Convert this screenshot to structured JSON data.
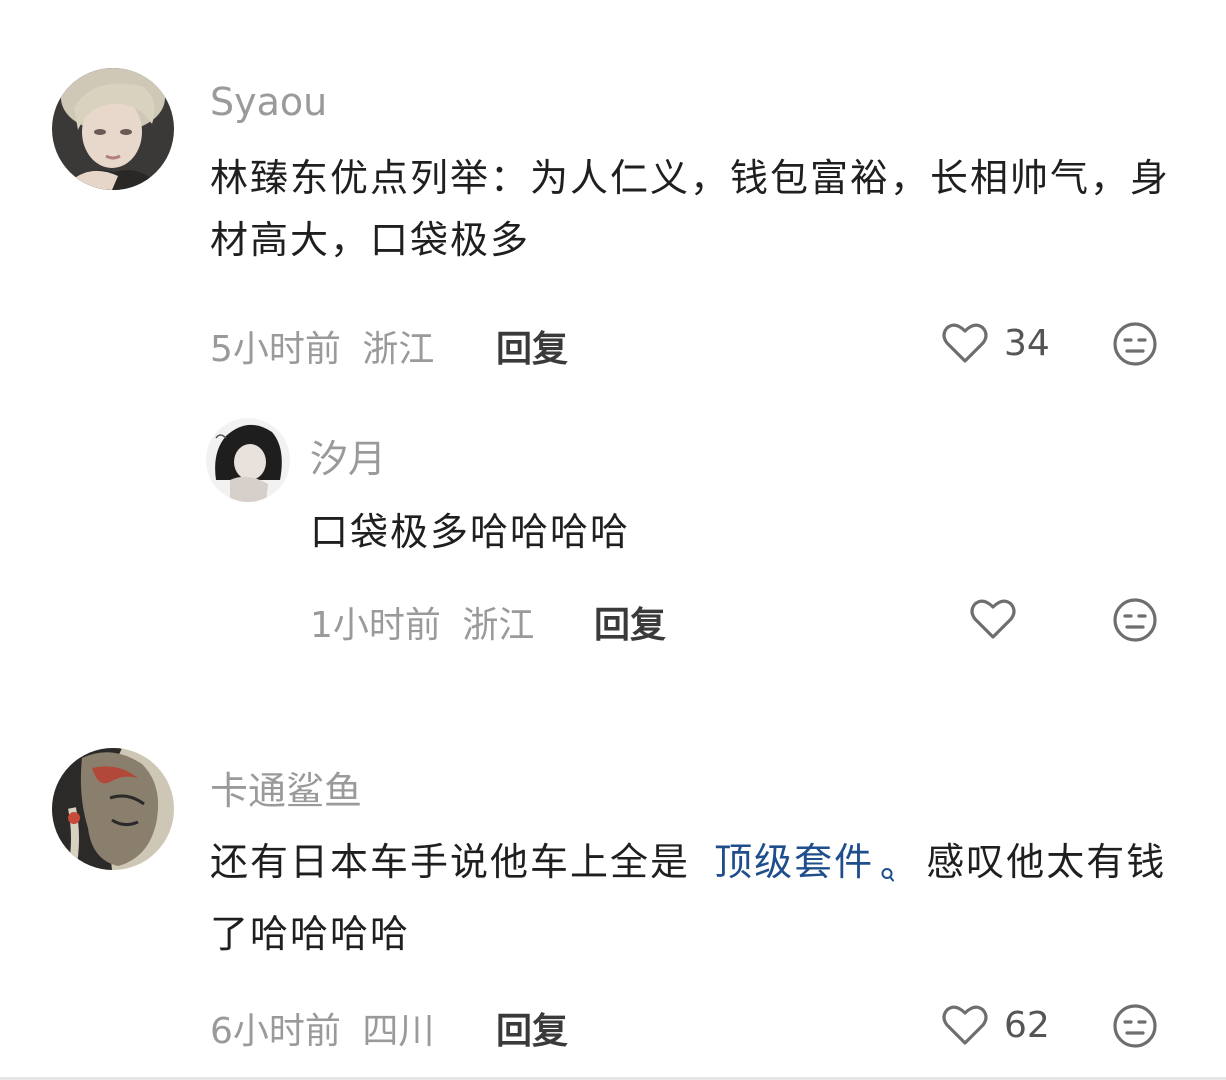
{
  "comments": [
    {
      "username": "Syaou",
      "text": "林臻东优点列举：为人仁义，钱包富裕，长相帅气，身材高大，口袋极多",
      "time": "5小时前",
      "location": "浙江",
      "reply_label": "回复",
      "likes": "34",
      "avatar_icon": "user-avatar-photo"
    },
    {
      "username": "汐月",
      "text": "口袋极多哈哈哈哈",
      "time": "1小时前",
      "location": "浙江",
      "reply_label": "回复",
      "likes": "",
      "avatar_icon": "user-avatar-photo"
    },
    {
      "username": "卡通鲨鱼",
      "text_before": "还有日本车手说他车上全是",
      "link_text": "顶级套件",
      "text_after": "感叹他太有钱了哈哈哈哈",
      "time": "6小时前",
      "location": "四川",
      "reply_label": "回复",
      "likes": "62",
      "avatar_icon": "user-avatar-illustration"
    }
  ],
  "icons": {
    "like": "heart-outline-icon",
    "emoji": "neutral-face-icon",
    "link_search": "search-icon"
  },
  "colors": {
    "username": "#9a9a9a",
    "meta": "#9a9a9a",
    "body_text": "#1f1f1f",
    "link": "#1f4e8c",
    "icon": "#6e6e6e"
  }
}
